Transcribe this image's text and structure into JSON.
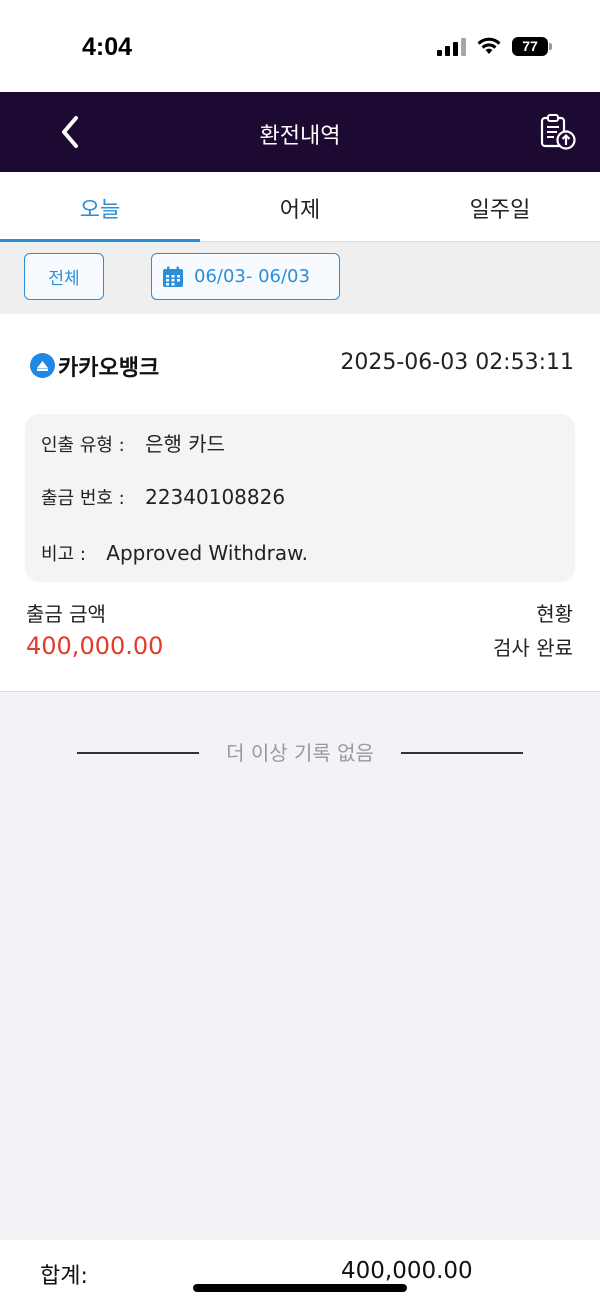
{
  "status_bar": {
    "time": "4:04",
    "battery": "77"
  },
  "header": {
    "title": "환전내역"
  },
  "tabs": [
    {
      "label": "오늘",
      "active": true
    },
    {
      "label": "어제",
      "active": false
    },
    {
      "label": "일주일",
      "active": false
    }
  ],
  "filter": {
    "all_label": "전체",
    "date_range": "06/03- 06/03"
  },
  "record": {
    "bank_name": "카카오뱅크",
    "datetime": "2025-06-03 02:53:11",
    "withdraw_type_label": "인출 유형 :",
    "withdraw_type_value": "은행 카드",
    "withdraw_no_label": "출금 번호 :",
    "withdraw_no_value": "22340108826",
    "note_label": "비고 :",
    "note_value": "Approved Withdraw.",
    "amount_label": "출금 금액",
    "amount_value": "400,000.00",
    "status_label": "현황",
    "status_value": "검사 완료"
  },
  "end_message": "더 이상 기록 없음",
  "footer": {
    "total_label": "합계:",
    "total_value": "400,000.00"
  },
  "colors": {
    "header_bg": "#1c0a33",
    "accent": "#2a8fd8",
    "amount": "#e53a2b"
  }
}
